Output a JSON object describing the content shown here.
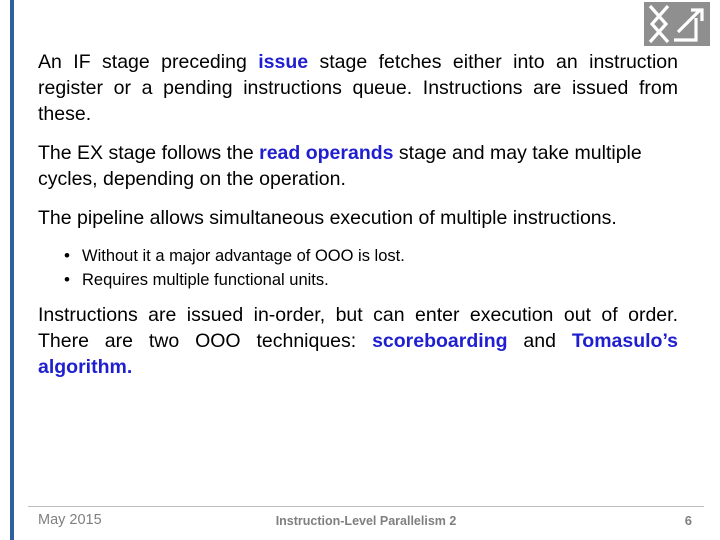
{
  "slide": {
    "logo_alt": "logo-mark",
    "paragraphs": [
      {
        "id": "p1",
        "justify": true,
        "runs": [
          {
            "text": "An IF stage preceding ",
            "highlight": false
          },
          {
            "text": "issue",
            "highlight": true
          },
          {
            "text": " stage fetches either into an instruction register or a pending instructions queue. Instructions are issued from these.",
            "highlight": false
          }
        ]
      },
      {
        "id": "p2",
        "justify": false,
        "runs": [
          {
            "text": "The EX stage follows the ",
            "highlight": false
          },
          {
            "text": "read operands",
            "highlight": true
          },
          {
            "text": " stage and may take multiple cycles, depending on the operation.",
            "highlight": false
          }
        ]
      },
      {
        "id": "p3",
        "justify": false,
        "runs": [
          {
            "text": "The pipeline allows simultaneous execution of multiple instructions.",
            "highlight": false
          }
        ]
      }
    ],
    "bullets": [
      "Without it a major advantage of OOO is lost.",
      "Requires multiple functional units."
    ],
    "paragraphs_after": [
      {
        "id": "p4",
        "justify": true,
        "runs": [
          {
            "text": "Instructions are issued in-order, but can enter execution out of order.  There are two OOO techniques: ",
            "highlight": false
          },
          {
            "text": "scoreboarding",
            "highlight": true
          },
          {
            "text": " and ",
            "highlight": false
          },
          {
            "text": "Tomasulo’s algorithm.",
            "highlight": true
          }
        ]
      }
    ],
    "footer": {
      "date": "May 2015",
      "center": "Instruction-Level Parallelism 2",
      "page": "6"
    },
    "colors": {
      "accent_bar": "#2f5f9e",
      "highlight_text": "#1f1fd0",
      "footer_text": "#7f7f7f",
      "logo_bg": "#8f8f8f"
    }
  }
}
